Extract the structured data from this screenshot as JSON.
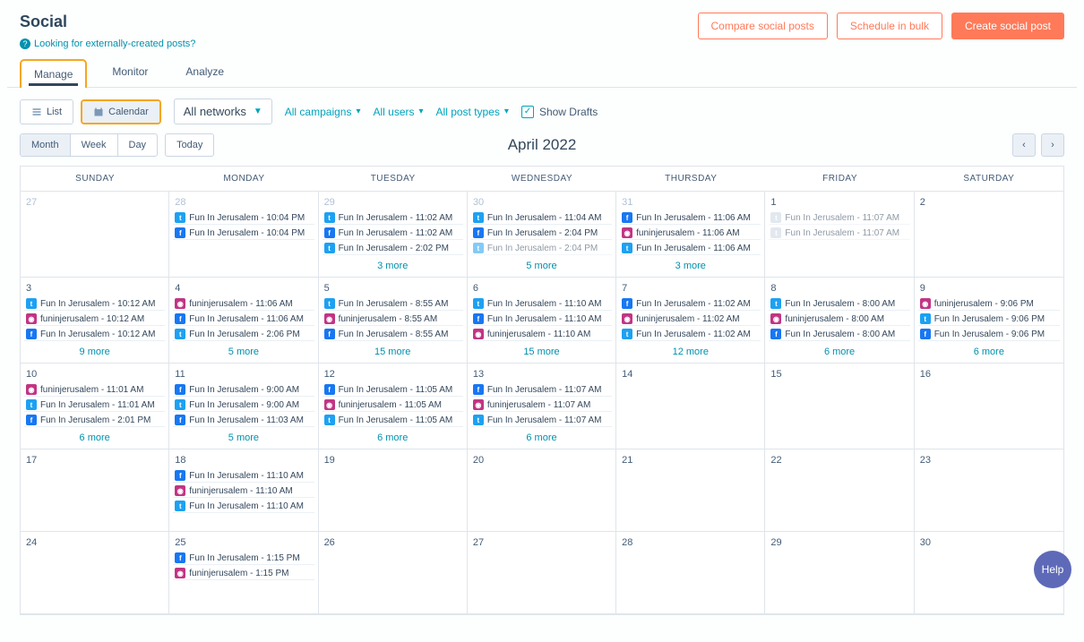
{
  "header": {
    "title": "Social",
    "external_link": "Looking for externally-created posts?",
    "buttons": {
      "compare": "Compare social posts",
      "bulk": "Schedule in bulk",
      "create": "Create social post"
    }
  },
  "tabs": {
    "manage": "Manage",
    "monitor": "Monitor",
    "analyze": "Analyze"
  },
  "filters": {
    "list": "List",
    "calendar": "Calendar",
    "networks": "All networks",
    "campaigns": "All campaigns",
    "users": "All users",
    "post_types": "All post types",
    "show_drafts": "Show Drafts"
  },
  "dateview": {
    "month": "Month",
    "week": "Week",
    "day": "Day",
    "today": "Today",
    "label": "April 2022"
  },
  "days": [
    "SUNDAY",
    "MONDAY",
    "TUESDAY",
    "WEDNESDAY",
    "THURSDAY",
    "FRIDAY",
    "SATURDAY"
  ],
  "cells": [
    {
      "num": "27",
      "muted": true,
      "events": [],
      "more": ""
    },
    {
      "num": "28",
      "muted": true,
      "events": [
        {
          "net": "twitter",
          "label": "Fun In Jerusalem - 10:04 PM"
        },
        {
          "net": "facebook",
          "label": "Fun In Jerusalem - 10:04 PM"
        }
      ],
      "more": ""
    },
    {
      "num": "29",
      "muted": true,
      "events": [
        {
          "net": "twitter",
          "label": "Fun In Jerusalem - 11:02 AM"
        },
        {
          "net": "facebook",
          "label": "Fun In Jerusalem - 11:02 AM"
        },
        {
          "net": "twitter",
          "label": "Fun In Jerusalem - 2:02 PM"
        }
      ],
      "more": "3 more"
    },
    {
      "num": "30",
      "muted": true,
      "events": [
        {
          "net": "twitter",
          "label": "Fun In Jerusalem - 11:04 AM"
        },
        {
          "net": "facebook",
          "label": "Fun In Jerusalem - 2:04 PM"
        },
        {
          "net": "twitter",
          "label": "Fun In Jerusalem - 2:04 PM",
          "muted": true
        }
      ],
      "more": "5 more"
    },
    {
      "num": "31",
      "muted": true,
      "events": [
        {
          "net": "facebook",
          "label": "Fun In Jerusalem - 11:06 AM"
        },
        {
          "net": "instagram",
          "label": "funinjerusalem - 11:06 AM"
        },
        {
          "net": "twitter",
          "label": "Fun In Jerusalem - 11:06 AM"
        }
      ],
      "more": "3 more"
    },
    {
      "num": "1",
      "events": [
        {
          "net": "grey",
          "label": "Fun In Jerusalem - 11:07 AM",
          "muted": true
        },
        {
          "net": "grey",
          "label": "Fun In Jerusalem - 11:07 AM",
          "muted": true
        }
      ],
      "more": ""
    },
    {
      "num": "2",
      "events": [],
      "more": ""
    },
    {
      "num": "3",
      "events": [
        {
          "net": "twitter",
          "label": "Fun In Jerusalem - 10:12 AM"
        },
        {
          "net": "instagram",
          "label": "funinjerusalem - 10:12 AM"
        },
        {
          "net": "facebook",
          "label": "Fun In Jerusalem - 10:12 AM"
        }
      ],
      "more": "9 more"
    },
    {
      "num": "4",
      "events": [
        {
          "net": "instagram",
          "label": "funinjerusalem - 11:06 AM"
        },
        {
          "net": "facebook",
          "label": "Fun In Jerusalem - 11:06 AM"
        },
        {
          "net": "twitter",
          "label": "Fun In Jerusalem - 2:06 PM"
        }
      ],
      "more": "5 more"
    },
    {
      "num": "5",
      "events": [
        {
          "net": "twitter",
          "label": "Fun In Jerusalem - 8:55 AM"
        },
        {
          "net": "instagram",
          "label": "funinjerusalem - 8:55 AM"
        },
        {
          "net": "facebook",
          "label": "Fun In Jerusalem - 8:55 AM"
        }
      ],
      "more": "15 more"
    },
    {
      "num": "6",
      "events": [
        {
          "net": "twitter",
          "label": "Fun In Jerusalem - 11:10 AM"
        },
        {
          "net": "facebook",
          "label": "Fun In Jerusalem - 11:10 AM"
        },
        {
          "net": "instagram",
          "label": "funinjerusalem - 11:10 AM"
        }
      ],
      "more": "15 more"
    },
    {
      "num": "7",
      "events": [
        {
          "net": "facebook",
          "label": "Fun In Jerusalem - 11:02 AM"
        },
        {
          "net": "instagram",
          "label": "funinjerusalem - 11:02 AM"
        },
        {
          "net": "twitter",
          "label": "Fun In Jerusalem - 11:02 AM"
        }
      ],
      "more": "12 more"
    },
    {
      "num": "8",
      "events": [
        {
          "net": "twitter",
          "label": "Fun In Jerusalem - 8:00 AM"
        },
        {
          "net": "instagram",
          "label": "funinjerusalem - 8:00 AM"
        },
        {
          "net": "facebook",
          "label": "Fun In Jerusalem - 8:00 AM"
        }
      ],
      "more": "6 more"
    },
    {
      "num": "9",
      "events": [
        {
          "net": "instagram",
          "label": "funinjerusalem - 9:06 PM"
        },
        {
          "net": "twitter",
          "label": "Fun In Jerusalem - 9:06 PM"
        },
        {
          "net": "facebook",
          "label": "Fun In Jerusalem - 9:06 PM"
        }
      ],
      "more": "6 more"
    },
    {
      "num": "10",
      "events": [
        {
          "net": "instagram",
          "label": "funinjerusalem - 11:01 AM"
        },
        {
          "net": "twitter",
          "label": "Fun In Jerusalem - 11:01 AM"
        },
        {
          "net": "facebook",
          "label": "Fun In Jerusalem - 2:01 PM"
        }
      ],
      "more": "6 more"
    },
    {
      "num": "11",
      "events": [
        {
          "net": "facebook",
          "label": "Fun In Jerusalem - 9:00 AM"
        },
        {
          "net": "twitter",
          "label": "Fun In Jerusalem - 9:00 AM"
        },
        {
          "net": "facebook",
          "label": "Fun In Jerusalem - 11:03 AM"
        }
      ],
      "more": "5 more"
    },
    {
      "num": "12",
      "events": [
        {
          "net": "facebook",
          "label": "Fun In Jerusalem - 11:05 AM"
        },
        {
          "net": "instagram",
          "label": "funinjerusalem - 11:05 AM"
        },
        {
          "net": "twitter",
          "label": "Fun In Jerusalem - 11:05 AM"
        }
      ],
      "more": "6 more"
    },
    {
      "num": "13",
      "events": [
        {
          "net": "facebook",
          "label": "Fun In Jerusalem - 11:07 AM"
        },
        {
          "net": "instagram",
          "label": "funinjerusalem - 11:07 AM"
        },
        {
          "net": "twitter",
          "label": "Fun In Jerusalem - 11:07 AM"
        }
      ],
      "more": "6 more"
    },
    {
      "num": "14",
      "events": [],
      "more": ""
    },
    {
      "num": "15",
      "events": [],
      "more": ""
    },
    {
      "num": "16",
      "events": [],
      "more": ""
    },
    {
      "num": "17",
      "events": [],
      "more": ""
    },
    {
      "num": "18",
      "events": [
        {
          "net": "facebook",
          "label": "Fun In Jerusalem - 11:10 AM"
        },
        {
          "net": "instagram",
          "label": "funinjerusalem - 11:10 AM"
        },
        {
          "net": "twitter",
          "label": "Fun In Jerusalem - 11:10 AM"
        }
      ],
      "more": ""
    },
    {
      "num": "19",
      "events": [],
      "more": ""
    },
    {
      "num": "20",
      "events": [],
      "more": ""
    },
    {
      "num": "21",
      "events": [],
      "more": ""
    },
    {
      "num": "22",
      "events": [],
      "more": ""
    },
    {
      "num": "23",
      "events": [],
      "more": ""
    },
    {
      "num": "24",
      "events": [],
      "more": ""
    },
    {
      "num": "25",
      "events": [
        {
          "net": "facebook",
          "label": "Fun In Jerusalem - 1:15 PM"
        },
        {
          "net": "instagram",
          "label": "funinjerusalem - 1:15 PM"
        }
      ],
      "more": ""
    },
    {
      "num": "26",
      "events": [],
      "more": ""
    },
    {
      "num": "27",
      "events": [],
      "more": ""
    },
    {
      "num": "28",
      "events": [],
      "more": ""
    },
    {
      "num": "29",
      "events": [],
      "more": ""
    },
    {
      "num": "30",
      "events": [],
      "more": ""
    }
  ],
  "help": "Help"
}
